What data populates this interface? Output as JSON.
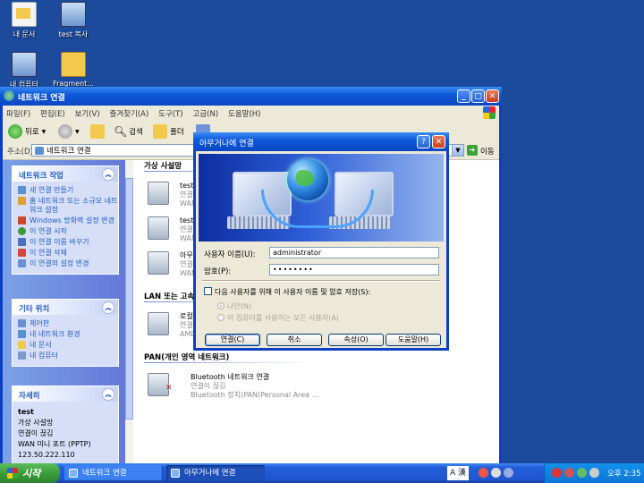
{
  "desktop": {
    "icons": [
      {
        "label": "내 문서"
      },
      {
        "label": "test 복사"
      },
      {
        "label": "내 컴퓨터"
      },
      {
        "label": "Fragment..."
      }
    ]
  },
  "explorer": {
    "title": "네트워크 연결",
    "menu": [
      "파일(F)",
      "편집(E)",
      "보기(V)",
      "즐겨찾기(A)",
      "도구(T)",
      "고급(N)",
      "도움말(H)"
    ],
    "toolbar": {
      "back": "뒤로",
      "search": "검색",
      "folders": "폴더"
    },
    "address": {
      "label": "주소(D)",
      "value": "네트워크 연결",
      "go": "이동"
    },
    "tasks": {
      "title": "네트워크 작업",
      "items": [
        "새 연결 만들기",
        "홈 네트워크 또는 소규모 네트워크 설정",
        "Windows 방화벽 설정 변경",
        "이 연결 시작",
        "이 연결 이름 바꾸기",
        "이 연결 삭제",
        "이 연결의 설정 변경"
      ]
    },
    "other": {
      "title": "기타 위치",
      "items": [
        "제어판",
        "내 네트워크 환경",
        "내 문서",
        "내 컴퓨터"
      ]
    },
    "details": {
      "title": "자세히",
      "name": "test",
      "lines": [
        "가상 사설망",
        "연결이 끊김",
        "WAN 미니 포트 (PPTP)",
        "123.50.222.110"
      ]
    },
    "groups": {
      "vpn": "가상 사설망",
      "lan": "LAN 또는 고속",
      "pan": "PAN(개인 영역 네트워크)"
    },
    "connections": {
      "vpn1": {
        "name": "test",
        "line1": "연결",
        "line2": "WAN"
      },
      "vpn2": {
        "name": "test",
        "line1": "연결",
        "line2": "WAN"
      },
      "vpn3": {
        "name": "아무",
        "line1": "연결",
        "line2": "WAN"
      },
      "lan1": {
        "name": "로컬",
        "line1": "연결",
        "line2": "AMD"
      },
      "bt": {
        "name": "Bluetooth 네트워크 연결",
        "line1": "연결이 끊김",
        "line2": "Bluetooth 장치(PAN(Personal Area ..."
      }
    }
  },
  "dialog": {
    "title": "아무거나에 연결",
    "username_label": "사용자 이름(U):",
    "username_value": "administrator",
    "password_label": "암호(P):",
    "password_value": "••••••••",
    "save_label": "다음 사용자를 위해 이 사용자 이름 및 암호 저장(S):",
    "radio_me": "나만(N)",
    "radio_all": "이 컴퓨터를 사용하는 모든 사용자(A)",
    "buttons": {
      "connect": "연결(C)",
      "cancel": "취소",
      "properties": "속성(O)",
      "help": "도움말(H)"
    }
  },
  "taskbar": {
    "start": "시작",
    "tasks": [
      "네트워크 연결",
      "아무거나에 연결"
    ],
    "lang": "A 漢",
    "clock": "오후 2:35"
  }
}
